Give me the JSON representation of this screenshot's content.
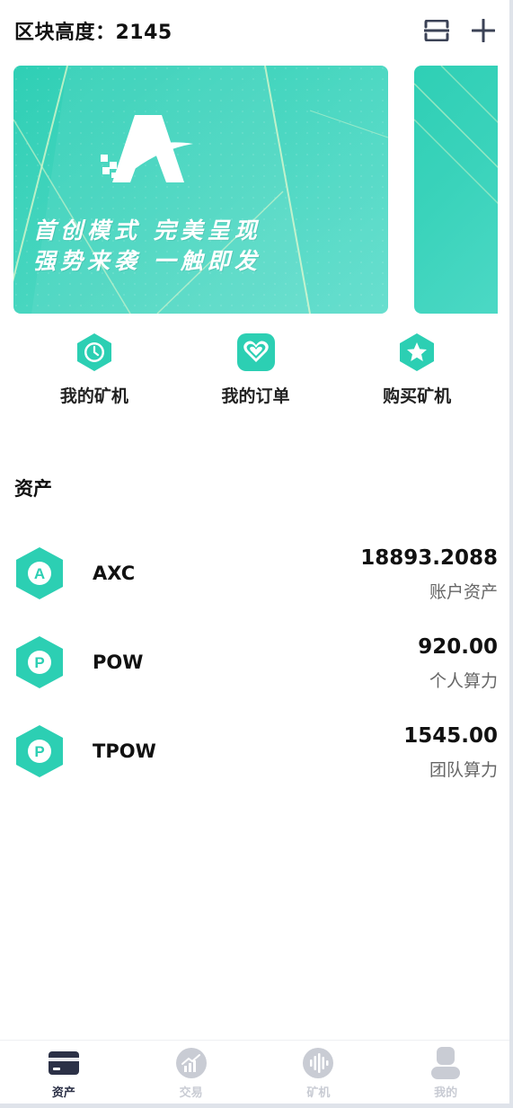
{
  "header": {
    "title": "区块高度：2145",
    "scan_icon": "scan-icon",
    "add_icon": "plus-icon"
  },
  "banner": {
    "line1": "首创模式 完美呈现",
    "line2": "强势来袭 一触即发",
    "logo_icon": "brand-logo-icon"
  },
  "quick_actions": [
    {
      "label": "我的矿机",
      "icon": "clock-icon"
    },
    {
      "label": "我的订单",
      "icon": "heart-icon"
    },
    {
      "label": "购买矿机",
      "icon": "star-icon"
    }
  ],
  "assets": {
    "title": "资产",
    "items": [
      {
        "letter": "A",
        "name": "AXC",
        "value": "18893.2088",
        "label": "账户资产"
      },
      {
        "letter": "P",
        "name": "POW",
        "value": "920.00",
        "label": "个人算力"
      },
      {
        "letter": "P",
        "name": "TPOW",
        "value": "1545.00",
        "label": "团队算力"
      }
    ]
  },
  "tabbar": {
    "items": [
      {
        "label": "资产",
        "icon": "wallet-icon",
        "active": true
      },
      {
        "label": "交易",
        "icon": "chart-trend-icon",
        "active": false
      },
      {
        "label": "矿机",
        "icon": "waveform-icon",
        "active": false
      },
      {
        "label": "我的",
        "icon": "user-icon",
        "active": false
      }
    ]
  },
  "colors": {
    "accent": "#2ccfb3",
    "text": "#111111",
    "subtext": "#666666",
    "tab_active": "#2c3147",
    "tab_inactive": "#c9ccd4"
  }
}
